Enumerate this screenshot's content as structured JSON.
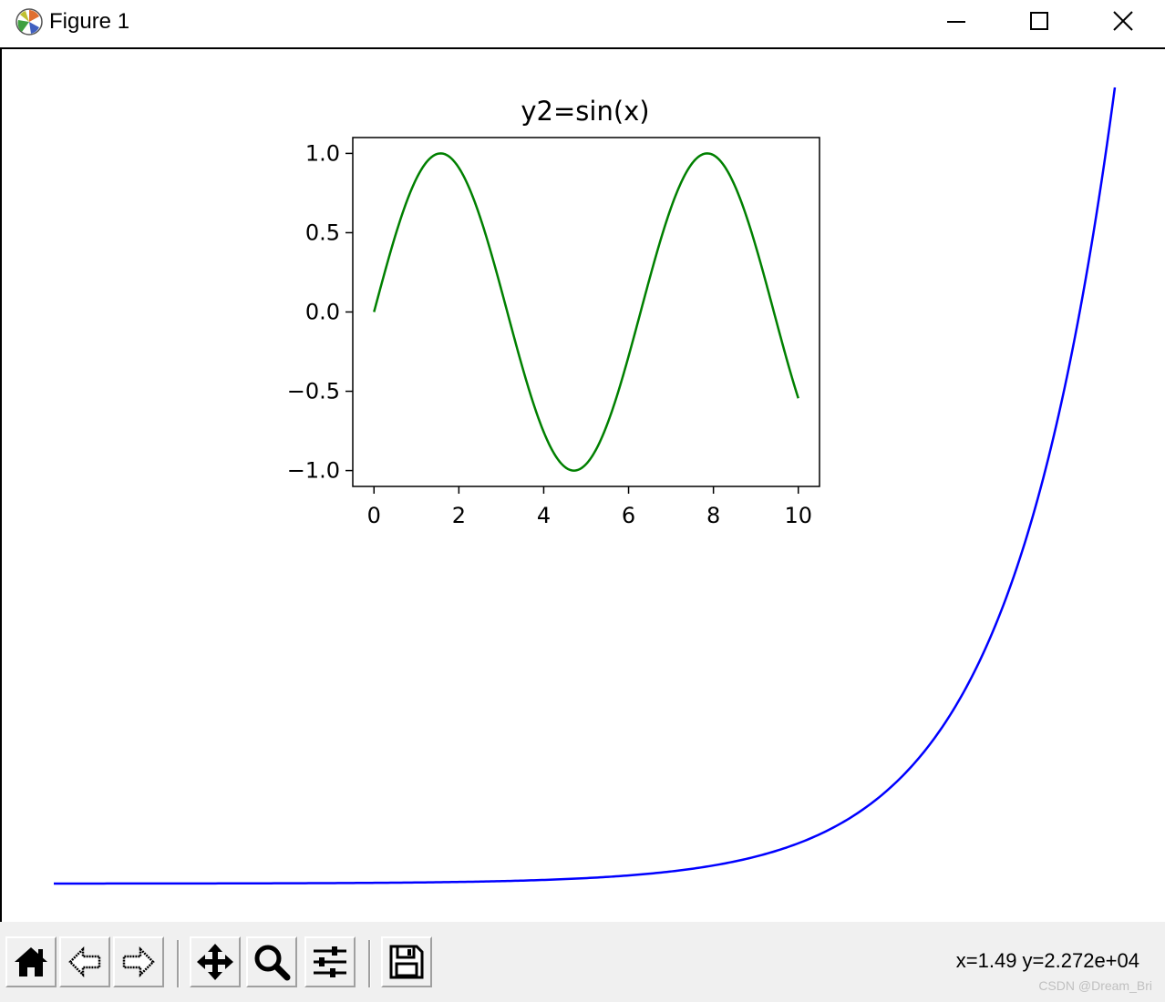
{
  "window": {
    "title": "Figure 1",
    "icon": "matplotlib-logo-icon"
  },
  "toolbar": {
    "buttons": [
      "home-icon",
      "back-arrow-icon",
      "forward-arrow-icon",
      "pan-move-icon",
      "zoom-magnifier-icon",
      "configure-subplots-icon",
      "save-floppy-icon"
    ],
    "coords": "x=1.49 y=2.272e+04"
  },
  "watermark": "CSDN @Dream_Bri",
  "chart_data": [
    {
      "type": "line",
      "title": "",
      "xlabel": "",
      "ylabel": "",
      "x": [
        0,
        1,
        2,
        3,
        4,
        5,
        6,
        7,
        8,
        9,
        10
      ],
      "series": [
        {
          "function": "exp(x)",
          "color": "#0000ff",
          "values": [
            1,
            2.718,
            7.389,
            20.09,
            54.6,
            148.4,
            403.4,
            1096.6,
            2981,
            8103,
            22026
          ]
        }
      ],
      "axes_visible": false,
      "xlim": [
        -0.5,
        10.5
      ]
    },
    {
      "type": "line",
      "title": "y2=sin(x)",
      "xlabel": "",
      "ylabel": "",
      "x_ticks": [
        "0",
        "2",
        "4",
        "6",
        "8",
        "10"
      ],
      "y_ticks": [
        "1.0",
        "0.5",
        "0.0",
        "−0.5",
        "−1.0"
      ],
      "x_tick_values": [
        0,
        2,
        4,
        6,
        8,
        10
      ],
      "y_tick_values": [
        1.0,
        0.5,
        0.0,
        -0.5,
        -1.0
      ],
      "xlim": [
        -0.5,
        10.5
      ],
      "ylim": [
        -1.1,
        1.1
      ],
      "series": [
        {
          "function": "sin(x)",
          "color": "#008000"
        }
      ],
      "x_range": [
        0,
        10
      ]
    }
  ]
}
